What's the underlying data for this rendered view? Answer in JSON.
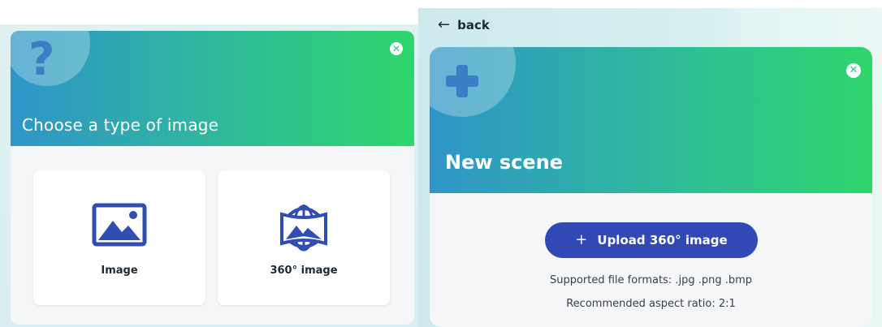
{
  "choose_dialog": {
    "title": "Choose a type of image",
    "header_icon": "question-mark-icon",
    "close_icon": "close-icon",
    "options": [
      {
        "label": "Image",
        "icon": "image-icon"
      },
      {
        "label": "360° image",
        "icon": "panorama-360-icon"
      }
    ],
    "colors": {
      "gradient_start": "#2f95c9",
      "gradient_end": "#2fd66c",
      "icon_blue": "#2f4db3"
    }
  },
  "new_scene_dialog": {
    "back_label": "back",
    "back_icon": "arrow-left-icon",
    "title": "New scene",
    "header_icon": "plus-icon",
    "close_icon": "close-icon",
    "upload_button": {
      "label": "Upload 360° image",
      "icon": "plus-icon"
    },
    "supported_formats": "Supported file formats: .jpg .png .bmp",
    "aspect_ratio": "Recommended aspect ratio: 2:1",
    "colors": {
      "button": "#3049b5"
    }
  }
}
